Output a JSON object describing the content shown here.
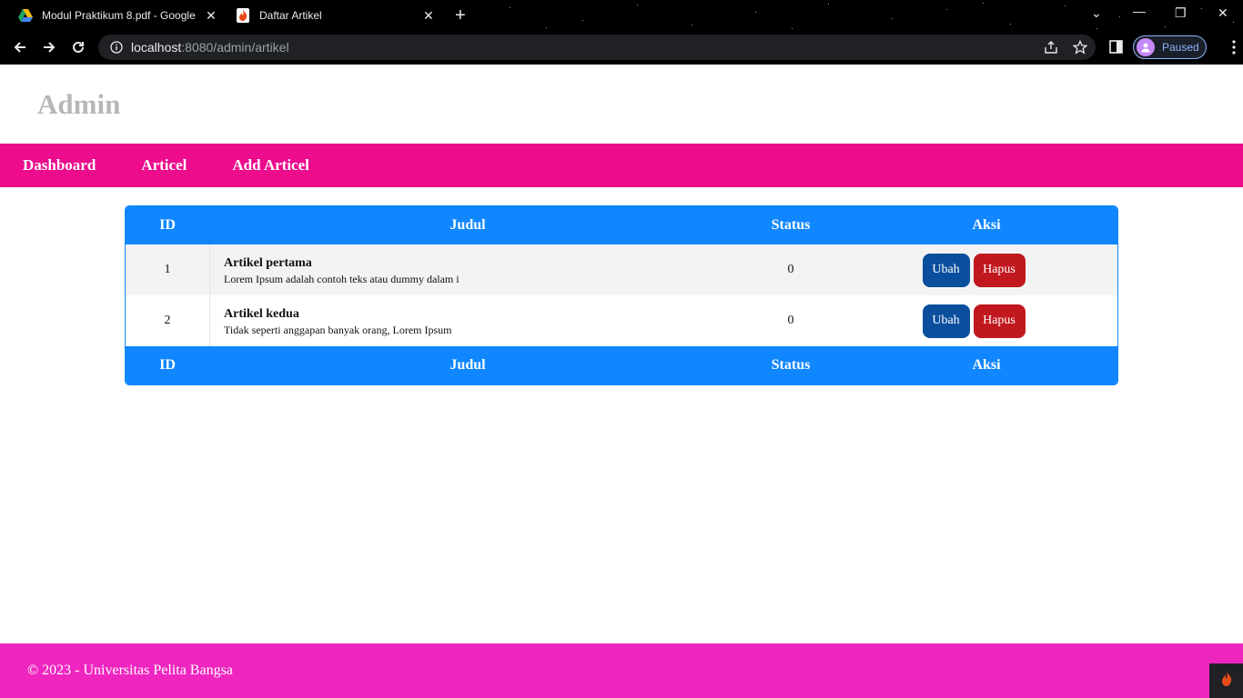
{
  "browser": {
    "tabs": [
      {
        "title": "Modul Praktikum 8.pdf - Google",
        "icon": "google-drive-icon"
      },
      {
        "title": "Daftar Artikel",
        "icon": "codeigniter-flame-icon"
      }
    ],
    "url_host": "localhost",
    "url_path": ":8080/admin/artikel",
    "profile_status": "Paused"
  },
  "page": {
    "title": "Admin",
    "nav": [
      "Dashboard",
      "Articel",
      "Add Articel"
    ],
    "table": {
      "headers": [
        "ID",
        "Judul",
        "Status",
        "Aksi"
      ],
      "rows": [
        {
          "id": "1",
          "title": "Artikel pertama",
          "desc": "Lorem Ipsum adalah contoh teks atau dummy dalam i",
          "status": "0",
          "edit_label": "Ubah",
          "delete_label": "Hapus"
        },
        {
          "id": "2",
          "title": "Artikel kedua",
          "desc": "Tidak seperti anggapan banyak orang, Lorem Ipsum",
          "status": "0",
          "edit_label": "Ubah",
          "delete_label": "Hapus"
        }
      ]
    },
    "footer": "© 2023 - Universitas Pelita Bangsa"
  },
  "colors": {
    "nav_bg": "#ec0c8c",
    "table_header_bg": "#1087ff",
    "edit_button": "#0a4f9e",
    "delete_button": "#c0181e",
    "footer_bg": "#ef25c0"
  }
}
